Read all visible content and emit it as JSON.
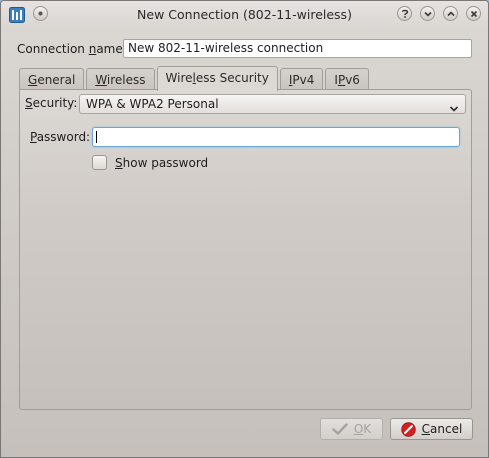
{
  "window": {
    "title": "New Connection (802-11-wireless)"
  },
  "connection": {
    "name_label_pre": "Connection ",
    "name_label_ul": "n",
    "name_label_post": "ame:",
    "name_value": "New 802-11-wireless connection"
  },
  "tabs": [
    {
      "pre": "",
      "ul": "G",
      "post": "eneral"
    },
    {
      "pre": "",
      "ul": "W",
      "post": "ireless"
    },
    {
      "pre": "Wire",
      "ul": "l",
      "post": "ess Security"
    },
    {
      "pre": "",
      "ul": "I",
      "post": "Pv4"
    },
    {
      "pre": "I",
      "ul": "P",
      "post": "v6"
    }
  ],
  "security": {
    "label_pre": "",
    "label_ul": "S",
    "label_post": "ecurity:",
    "value": "WPA & WPA2 Personal"
  },
  "password": {
    "label_pre": "",
    "label_ul": "P",
    "label_post": "assword:",
    "value": ""
  },
  "show_password": {
    "pre": "",
    "ul": "S",
    "post": "how password"
  },
  "buttons": {
    "ok": {
      "pre": "",
      "ul": "O",
      "post": "K"
    },
    "cancel": {
      "pre": "",
      "ul": "C",
      "post": "ancel"
    }
  },
  "colors": {
    "cancel_icon": "#d42020",
    "ok_icon_disabled": "#a6a29e",
    "password_focus": "#68a9d8"
  },
  "icons": {
    "app": "network-app-icon",
    "pin": "pin-icon",
    "help": "help-icon",
    "minimize": "minimize-icon",
    "maximize": "maximize-icon",
    "close": "close-icon",
    "ok": "checkmark-icon",
    "cancel": "cancel-icon"
  }
}
